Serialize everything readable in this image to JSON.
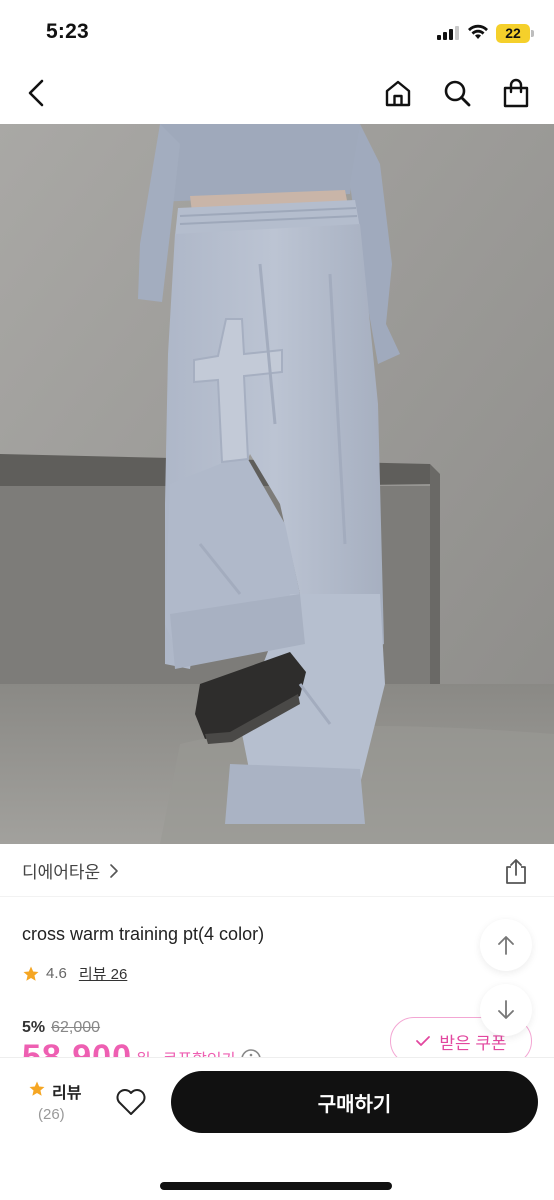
{
  "status_bar": {
    "time": "5:23",
    "battery": "22"
  },
  "nav": {
    "back_icon": "chevron-left-icon",
    "home_icon": "home-icon",
    "search_icon": "search-icon",
    "cart_icon": "shopping-bag-icon"
  },
  "product": {
    "brand": "디에어타운",
    "title": "cross warm training pt(4 color)",
    "rating": "4.6",
    "review_link": "리뷰 26",
    "discount_rate": "5%",
    "original_price": "62,000",
    "sale_price": "58,900",
    "price_unit": "원",
    "coupon_price_label": "쿠폰할인가",
    "coupon_button": "받은 쿠폰"
  },
  "bottom_bar": {
    "review_label": "리뷰",
    "review_count": "(26)",
    "buy_button": "구매하기"
  },
  "colors": {
    "accent_pink": "#ee5fb2",
    "star": "#f5a623",
    "buy_button_bg": "#111111",
    "battery": "#f5d02b"
  }
}
